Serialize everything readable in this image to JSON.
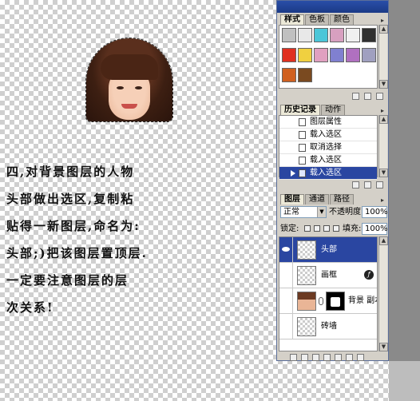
{
  "instructions": {
    "lines": [
      "四,对背景图层的人物",
      "头部做出选区,复制粘",
      "贴得一新图层,命名为:",
      "头部;)把该图层置顶层.",
      "一定要注意图层的层",
      "次关系!"
    ]
  },
  "styles_panel": {
    "tabs": [
      "样式",
      "色板",
      "颜色"
    ],
    "active_tab": "样式",
    "swatch_colors": [
      "#c0c0c0",
      "#e8e8e8",
      "#4bc6d8",
      "#d8a0c0",
      "#f0f0f0",
      "#303030",
      "#e03020",
      "#f0d040",
      "#e0a0c0",
      "#8080d0",
      "#b070c0",
      "#a0a0c0",
      "#d06020",
      "#7a4a20"
    ]
  },
  "history_panel": {
    "tabs": [
      "历史记录",
      "动作"
    ],
    "active_tab": "历史记录",
    "items": [
      "图层属性",
      "载入选区",
      "取消选择",
      "载入选区",
      "载入选区"
    ],
    "selected_index": 4
  },
  "layers_panel": {
    "tabs": [
      "图层",
      "通道",
      "路径"
    ],
    "active_tab": "图层",
    "blend_mode": "正常",
    "opacity_label": "不透明度:",
    "opacity_value": "100%",
    "lock_label": "锁定:",
    "fill_label": "填充:",
    "fill_value": "100%",
    "layers": [
      {
        "name": "头部",
        "visible": true,
        "selected": true
      },
      {
        "name": "画框",
        "visible": false,
        "selected": false,
        "has_fx": true
      },
      {
        "name": "背景 副本",
        "visible": false,
        "selected": false,
        "has_mask": true
      },
      {
        "name": "砖墙",
        "visible": false,
        "selected": false
      }
    ]
  },
  "colors": {
    "selection_blue": "#2a46a1",
    "panel_gray": "#d4d0c8",
    "title_blue": "#2a4ea8"
  }
}
